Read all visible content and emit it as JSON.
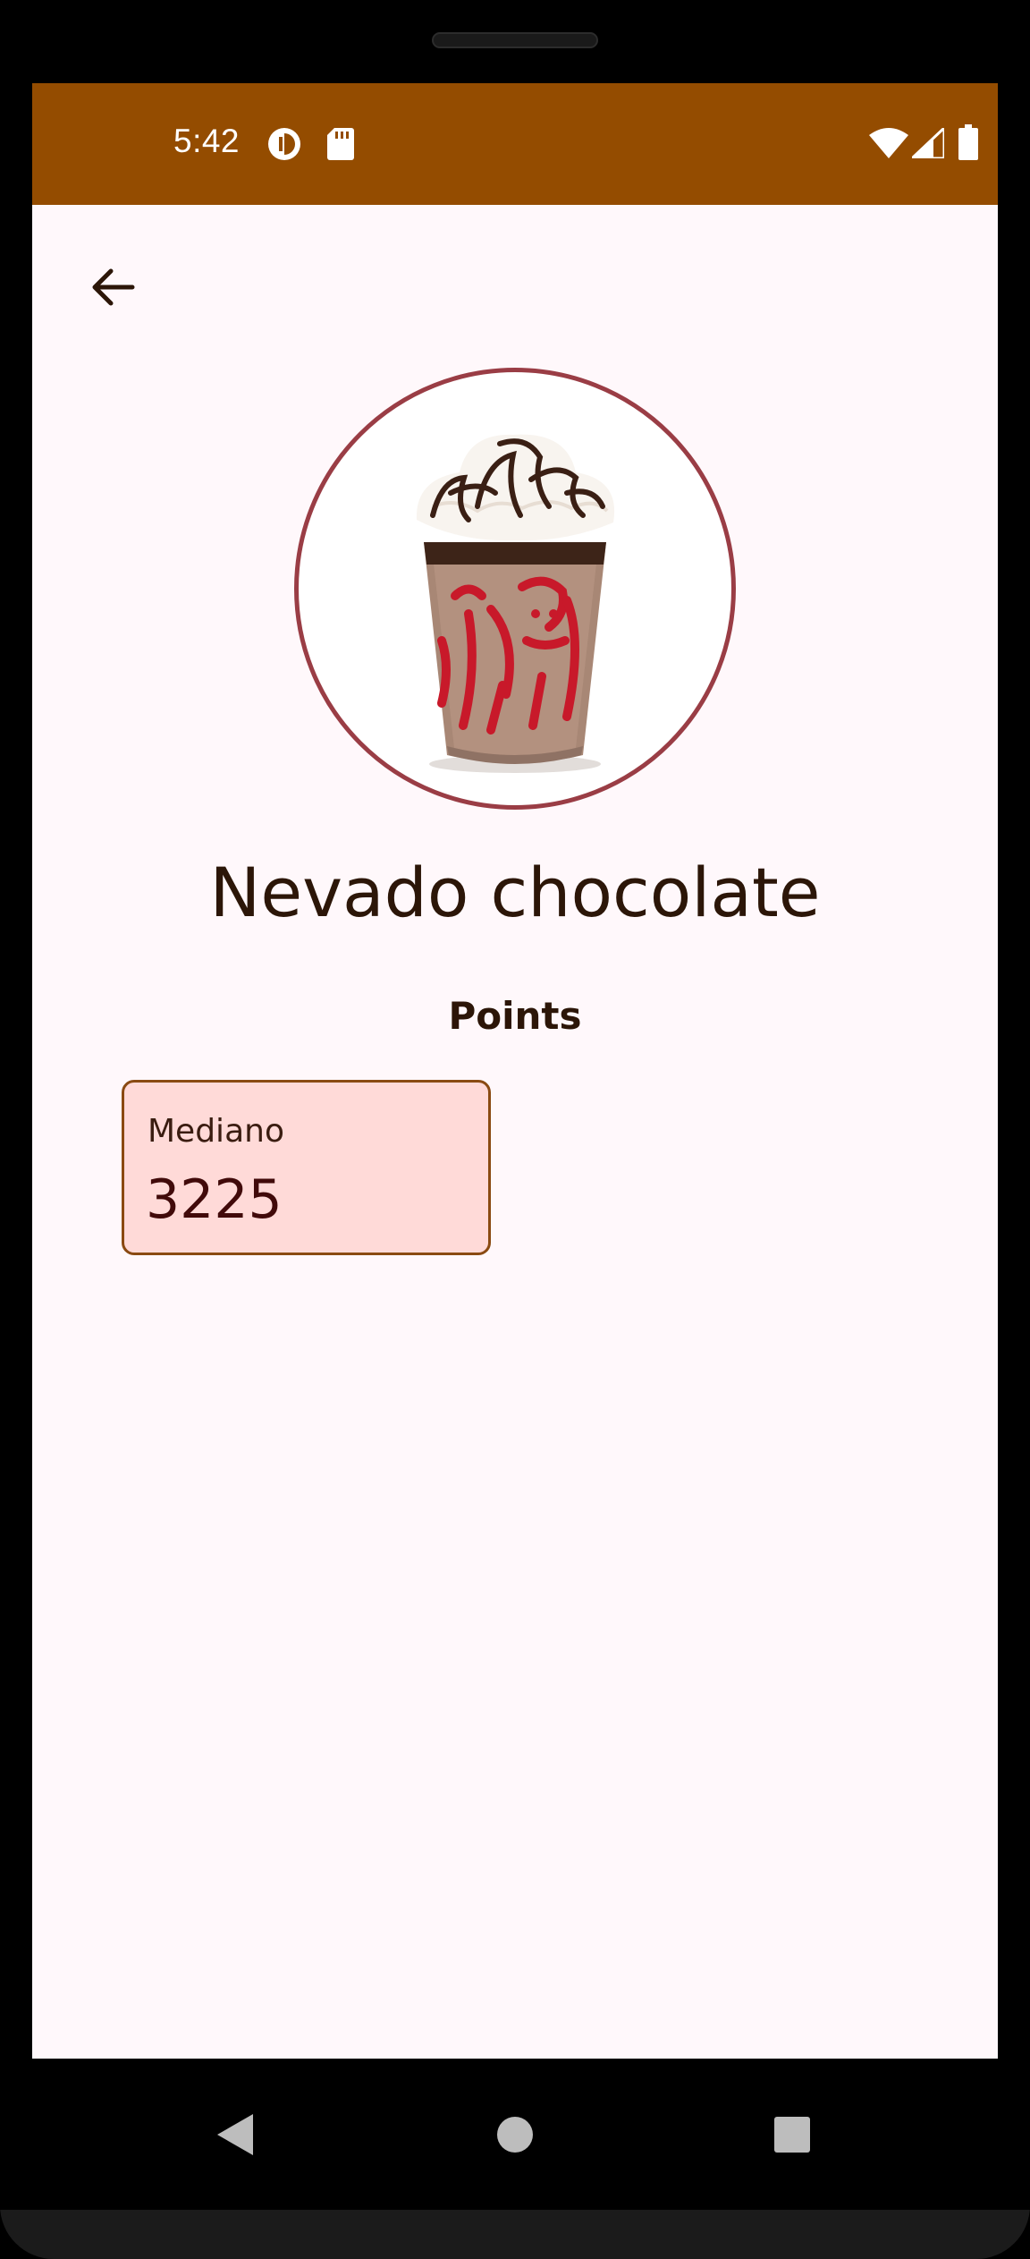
{
  "status_bar": {
    "time": "5:42",
    "background_color": "#944c00",
    "left_icons": [
      "data-saver-icon",
      "sd-card-icon"
    ],
    "right_icons": [
      "wifi-icon",
      "cell-signal-icon",
      "battery-icon"
    ]
  },
  "app_bar": {
    "back_icon": "arrow-back-icon"
  },
  "product": {
    "name": "Nevado chocolate",
    "image": "frozen-chocolate-drink-image"
  },
  "points": {
    "heading": "Points",
    "items": [
      {
        "size": "Mediano",
        "value": "3225"
      }
    ]
  },
  "nav_bar": {
    "buttons": [
      "back-triangle-icon",
      "home-circle-icon",
      "recents-square-icon"
    ]
  },
  "colors": {
    "accent": "#944c00",
    "background": "#fff8fb",
    "card_fill": "#ffdad8",
    "card_border": "#8a4a12",
    "image_ring": "#9a3d45",
    "text": "#2c1608"
  }
}
